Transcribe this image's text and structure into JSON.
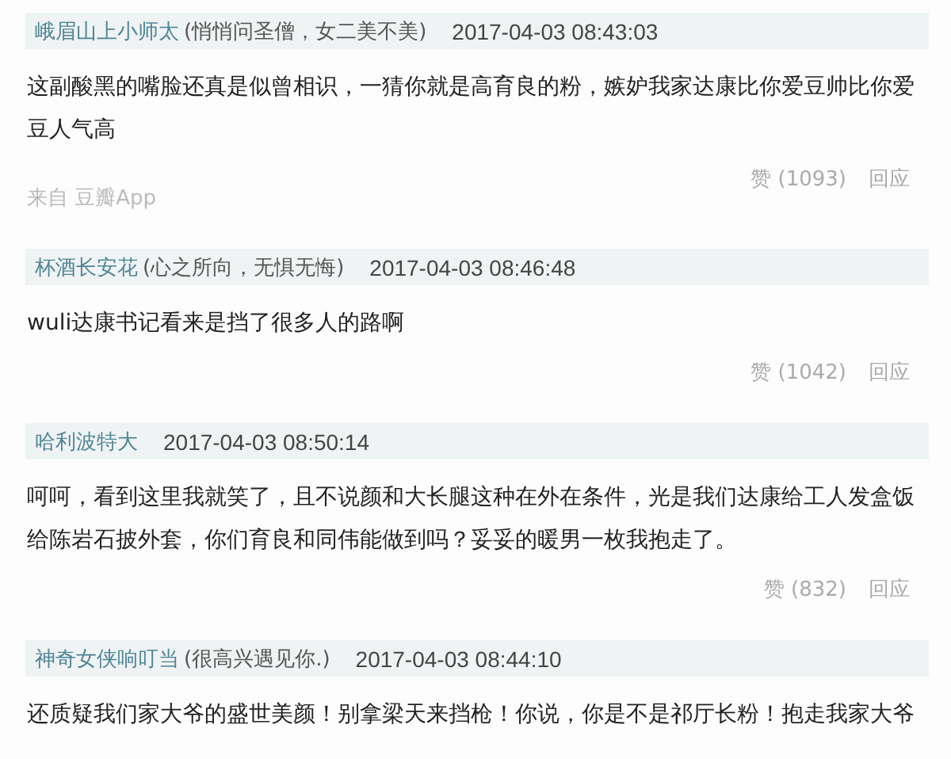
{
  "comments": [
    {
      "author": "峨眉山上小师太",
      "signature": "(悄悄问圣僧，女二美不美)",
      "time": "2017-04-03 08:43:03",
      "text": "这副酸黑的嘴脸还真是似曾相识，一猜你就是高育良的粉，嫉妒我家达康比你爱豆帅比你爱豆人气高",
      "likes": "赞 (1093)",
      "reply": "回应",
      "source": "来自 豆瓣App"
    },
    {
      "author": "杯酒长安花",
      "signature": "(心之所向，无惧无悔)",
      "time": "2017-04-03 08:46:48",
      "text": "wuli达康书记看来是挡了很多人的路啊",
      "likes": "赞 (1042)",
      "reply": "回应"
    },
    {
      "author": "哈利波特大",
      "time": "2017-04-03 08:50:14",
      "text": "呵呵，看到这里我就笑了，且不说颜和大长腿这种在外在条件，光是我们达康给工人发盒饭给陈岩石披外套，你们育良和同伟能做到吗？妥妥的暖男一枚我抱走了。",
      "likes": "赞 (832)",
      "reply": "回应"
    },
    {
      "author": "神奇女侠响叮当",
      "signature": "(很高兴遇见你.)",
      "time": "2017-04-03 08:44:10",
      "text": "还质疑我们家大爷的盛世美颜！别拿梁天来挡枪！你说，你是不是祁厅长粉！抱走我家大爷"
    }
  ]
}
